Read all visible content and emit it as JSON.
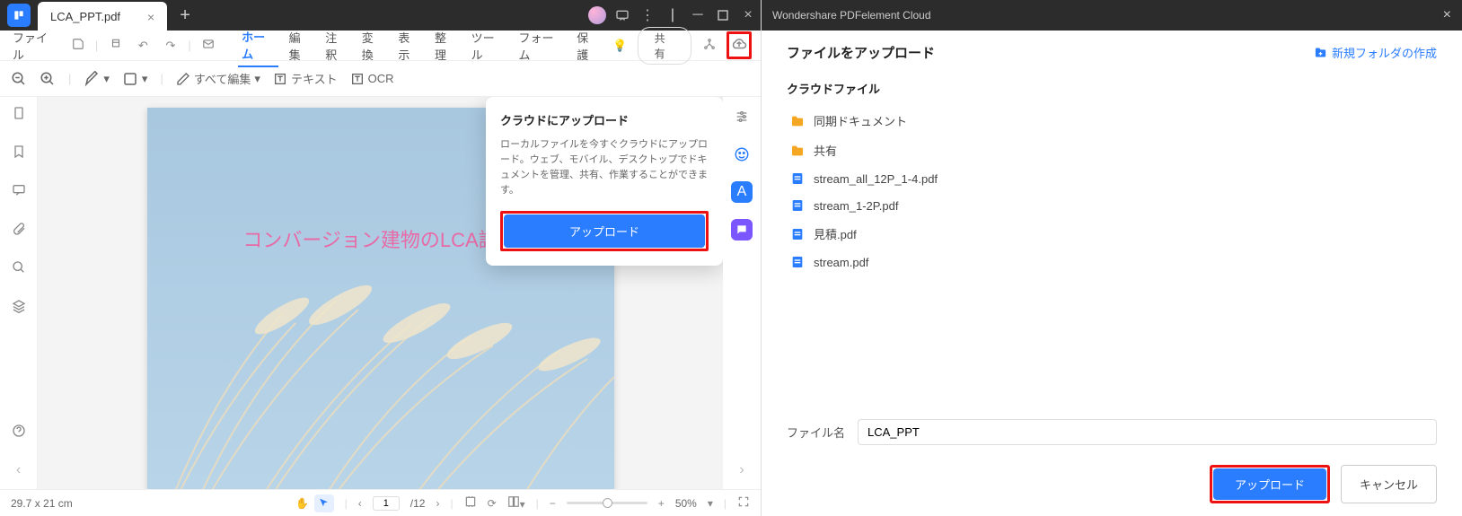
{
  "left": {
    "tab_title": "LCA_PPT.pdf",
    "menus": {
      "file": "ファイル",
      "home": "ホーム",
      "edit": "編集",
      "annotate": "注釈",
      "convert": "変換",
      "view": "表示",
      "organize": "整理",
      "tool": "ツール",
      "form": "フォーム",
      "protect": "保護"
    },
    "share": "共有",
    "toolbar": {
      "edit_all": "すべて編集",
      "text": "テキスト",
      "ocr": "OCR"
    },
    "page_heading": "コンバージョン建物のLCA試算",
    "popup": {
      "title": "クラウドにアップロード",
      "body": "ローカルファイルを今すぐクラウドにアップロード。ウェブ、モバイル、デスクトップでドキュメントを管理、共有、作業することができます。",
      "button": "アップロード"
    },
    "status": {
      "dims": "29.7 x 21 cm",
      "page": "1",
      "total": "/12",
      "zoom": "50%"
    }
  },
  "right": {
    "window_title": "Wondershare PDFelement Cloud",
    "heading": "ファイルをアップロード",
    "new_folder": "新規フォルダの作成",
    "section": "クラウドファイル",
    "items": [
      {
        "type": "folder",
        "name": "同期ドキュメント"
      },
      {
        "type": "folder",
        "name": "共有"
      },
      {
        "type": "pdf",
        "name": "stream_all_12P_1-4.pdf"
      },
      {
        "type": "pdf",
        "name": "stream_1-2P.pdf"
      },
      {
        "type": "pdf",
        "name": "見積.pdf"
      },
      {
        "type": "pdf",
        "name": "stream.pdf"
      }
    ],
    "filename_label": "ファイル名",
    "filename_value": "LCA_PPT",
    "upload": "アップロード",
    "cancel": "キャンセル"
  }
}
